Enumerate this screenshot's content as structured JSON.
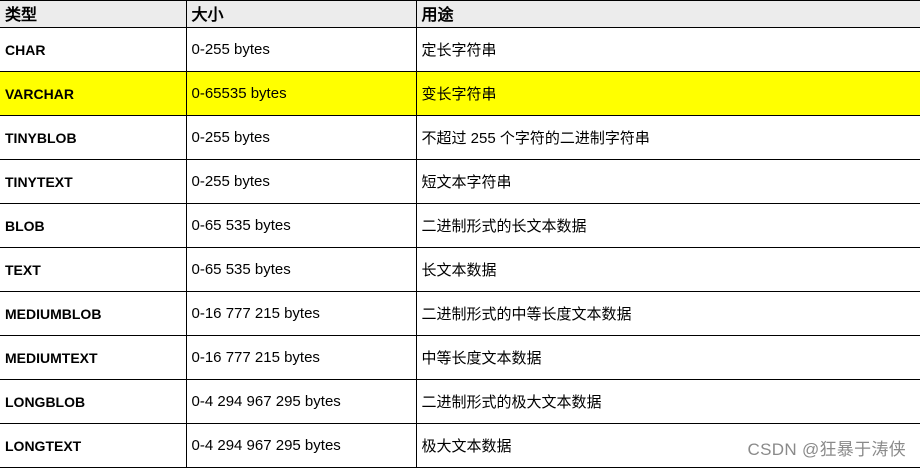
{
  "table": {
    "headers": [
      "类型",
      "大小",
      "用途"
    ],
    "rows": [
      {
        "type": "CHAR",
        "size": "0-255 bytes",
        "use": "定长字符串",
        "highlighted": false
      },
      {
        "type": "VARCHAR",
        "size": "0-65535 bytes",
        "use": "变长字符串",
        "highlighted": true
      },
      {
        "type": "TINYBLOB",
        "size": "0-255 bytes",
        "use": "不超过 255 个字符的二进制字符串",
        "highlighted": false
      },
      {
        "type": "TINYTEXT",
        "size": "0-255 bytes",
        "use": "短文本字符串",
        "highlighted": false
      },
      {
        "type": "BLOB",
        "size": "0-65 535 bytes",
        "use": "二进制形式的长文本数据",
        "highlighted": false
      },
      {
        "type": "TEXT",
        "size": "0-65 535 bytes",
        "use": "长文本数据",
        "highlighted": false
      },
      {
        "type": "MEDIUMBLOB",
        "size": "0-16 777 215 bytes",
        "use": "二进制形式的中等长度文本数据",
        "highlighted": false
      },
      {
        "type": "MEDIUMTEXT",
        "size": "0-16 777 215 bytes",
        "use": "中等长度文本数据",
        "highlighted": false
      },
      {
        "type": "LONGBLOB",
        "size": "0-4 294 967 295 bytes",
        "use": "二进制形式的极大文本数据",
        "highlighted": false
      },
      {
        "type": "LONGTEXT",
        "size": "0-4 294 967 295 bytes",
        "use": "极大文本数据",
        "highlighted": false
      }
    ]
  },
  "watermark": "CSDN @狂暴于涛侠",
  "colors": {
    "highlight": "#ffff00",
    "header_bg": "#ececec",
    "watermark": "#8a8a8a"
  }
}
